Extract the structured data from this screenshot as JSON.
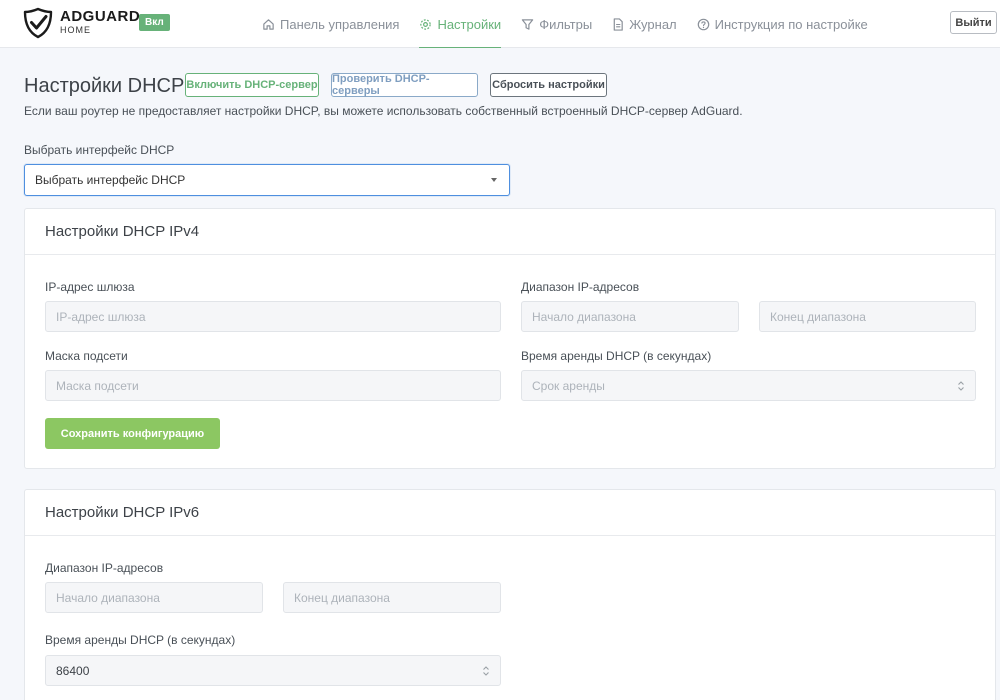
{
  "header": {
    "brand": "ADGUARD",
    "brand_sub": "HOME",
    "status_badge": "Вкл",
    "logout": "Выйти",
    "nav": [
      {
        "label": "Панель управления",
        "icon": "home-icon"
      },
      {
        "label": "Настройки",
        "icon": "gear-icon",
        "active": true
      },
      {
        "label": "Фильтры",
        "icon": "filter-icon"
      },
      {
        "label": "Журнал",
        "icon": "document-icon"
      },
      {
        "label": "Инструкция по настройке",
        "icon": "help-circle-icon"
      }
    ]
  },
  "page": {
    "title": "Настройки DHCP",
    "enable_button": "Включить DHCP-сервер",
    "check_button": "Проверить DHCP-серверы",
    "reset_button": "Сбросить настройки",
    "description": "Если ваш роутер не предоставляет настройки DHCP, вы можете использовать собственный встроенный DHCP-сервер AdGuard.",
    "interface_label": "Выбрать интерфейс DHCP",
    "interface_select": "Выбрать интерфейс DHCP"
  },
  "ipv4": {
    "title": "Настройки DHCP IPv4",
    "gateway_label": "IP-адрес шлюза",
    "gateway_placeholder": "IP-адрес шлюза",
    "range_label": "Диапазон IP-адресов",
    "range_start_placeholder": "Начало диапазона",
    "range_end_placeholder": "Конец диапазона",
    "mask_label": "Маска подсети",
    "mask_placeholder": "Маска подсети",
    "lease_label": "Время аренды DHCP (в секундах)",
    "lease_placeholder": "Срок аренды",
    "save_button": "Сохранить конфигурацию"
  },
  "ipv6": {
    "title": "Настройки DHCP IPv6",
    "range_label": "Диапазон IP-адресов",
    "range_start_placeholder": "Начало диапазона",
    "range_end_placeholder": "Конец диапазона",
    "lease_label": "Время аренды DHCP (в секундах)",
    "lease_value": "86400"
  },
  "colors": {
    "accent": "#67b279",
    "save_button": "#8cc762",
    "focus_border": "#4e8fdf"
  }
}
